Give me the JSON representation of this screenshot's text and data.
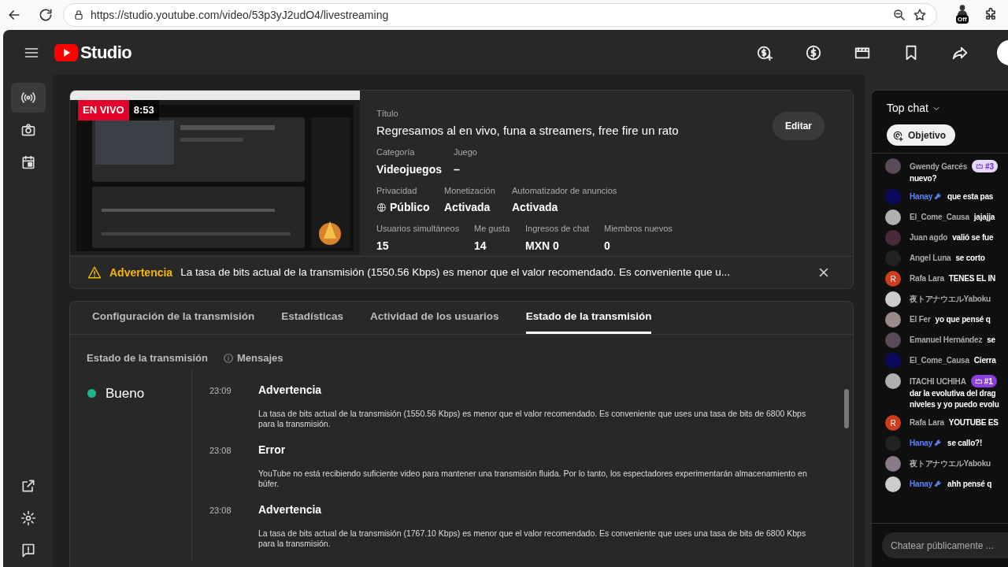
{
  "browser": {
    "url": "https://studio.youtube.com/video/53p3yJ2udO4/livestreaming",
    "extension_badge": "Off"
  },
  "header": {
    "logo": "Studio"
  },
  "nav": {
    "top": [
      {
        "selected": true
      },
      {
        "selected": false
      },
      {
        "selected": false
      }
    ]
  },
  "preview": {
    "live_badge": "EN VIVO",
    "elapsed": "8:53"
  },
  "details": {
    "title_label": "Título",
    "title": "Regresamos al en vivo, funa a streamers, free fire un rato",
    "edit_button": "Editar",
    "rows": [
      [
        {
          "label": "Categoría",
          "value": "Videojuegos"
        },
        {
          "label": "Juego",
          "value": "–"
        }
      ],
      [
        {
          "label": "Privacidad",
          "value": "Público",
          "kind": "globe"
        },
        {
          "label": "Monetización",
          "value": "Activada"
        },
        {
          "label": "Automatizador de anuncios",
          "value": "Activada"
        }
      ],
      [
        {
          "label": "Usuarios simultáneos",
          "value": "15"
        },
        {
          "label": "Me gusta",
          "value": "14"
        },
        {
          "label": "Ingresos de chat",
          "value": "MXN 0"
        },
        {
          "label": "Miembros nuevos",
          "value": "0"
        }
      ]
    ]
  },
  "warning": {
    "label": "Advertencia",
    "text": "La tasa de bits actual de la transmisión (1550.56 Kbps) es menor que el valor recomendado. Es conveniente que u..."
  },
  "tabs": [
    {
      "label": "Configuración de la transmisión",
      "selected": false
    },
    {
      "label": "Estadísticas",
      "selected": false
    },
    {
      "label": "Actividad de los usuarios",
      "selected": false
    },
    {
      "label": "Estado de la transmisión",
      "selected": true
    }
  ],
  "status": {
    "heading": "Estado de la transmisión",
    "messages_heading": "Mensajes",
    "state": "Bueno",
    "color": "#1fb58a",
    "messages": [
      {
        "time": "23:09",
        "title": "Advertencia",
        "body": "La tasa de bits actual de la transmisión (1550.56 Kbps) es menor que el valor recomendado. Es conveniente que uses una tasa de bits de 6800 Kbps para la transmisión."
      },
      {
        "time": "23:08",
        "title": "Error",
        "body": "YouTube no está recibiendo suficiente video para mantener una transmisión fluida. Por lo tanto, los espectadores experimentarán almacenamiento en búfer."
      },
      {
        "time": "23:08",
        "title": "Advertencia",
        "body": "La tasa de bits actual de la transmisión (1767.10 Kbps) es menor que el valor recomendado. Es conveniente que uses una tasa de bits de 6800 Kbps para la transmisión."
      }
    ]
  },
  "chat": {
    "title": "Top chat",
    "goal_button": "Objetivo",
    "placeholder": "Chatear públicamente ...",
    "messages": [
      {
        "author": "Gwendy Garcés",
        "badge": {
          "text": "#3",
          "color": "#e6d7fb"
        },
        "lines": [
          "nuevo?"
        ]
      },
      {
        "author": "Hanay",
        "kind": "moderator",
        "lines": [
          "que esta pas"
        ]
      },
      {
        "author": "El_Come_Causa",
        "lines": [
          "jajajja"
        ]
      },
      {
        "author": "Juan agdo",
        "lines": [
          "valió se fue"
        ]
      },
      {
        "author": "Angel Luna",
        "lines": [
          "se corto"
        ]
      },
      {
        "author": "Rafa Lara",
        "avatar_letter": "R",
        "lines": [
          "TENES EL IN"
        ]
      },
      {
        "author": "夜トアナウエルYaboku"
      },
      {
        "author": "El Fer",
        "lines": [
          "yo que pensé q"
        ]
      },
      {
        "author": "Emanuel Hernández",
        "lines": [
          "se"
        ]
      },
      {
        "author": "El_Come_Causa",
        "lines": [
          "Cierra"
        ]
      },
      {
        "author": "ITACHI UCHIHA",
        "badge": {
          "text": "#1",
          "color": "#8b3fe0"
        },
        "lines": [
          "dar la evolutiva del drag",
          "niveles y yo puedo evolu"
        ]
      },
      {
        "author": "Rafa Lara",
        "avatar_letter": "R",
        "lines": [
          "YOUTUBE ES"
        ]
      },
      {
        "author": "Hanay",
        "kind": "moderator",
        "lines": [
          "se callo?!"
        ]
      },
      {
        "author": "夜トアナウエルYaboku"
      },
      {
        "author": "Hanay",
        "kind": "moderator",
        "lines": [
          "ahh pensé q"
        ]
      }
    ]
  }
}
